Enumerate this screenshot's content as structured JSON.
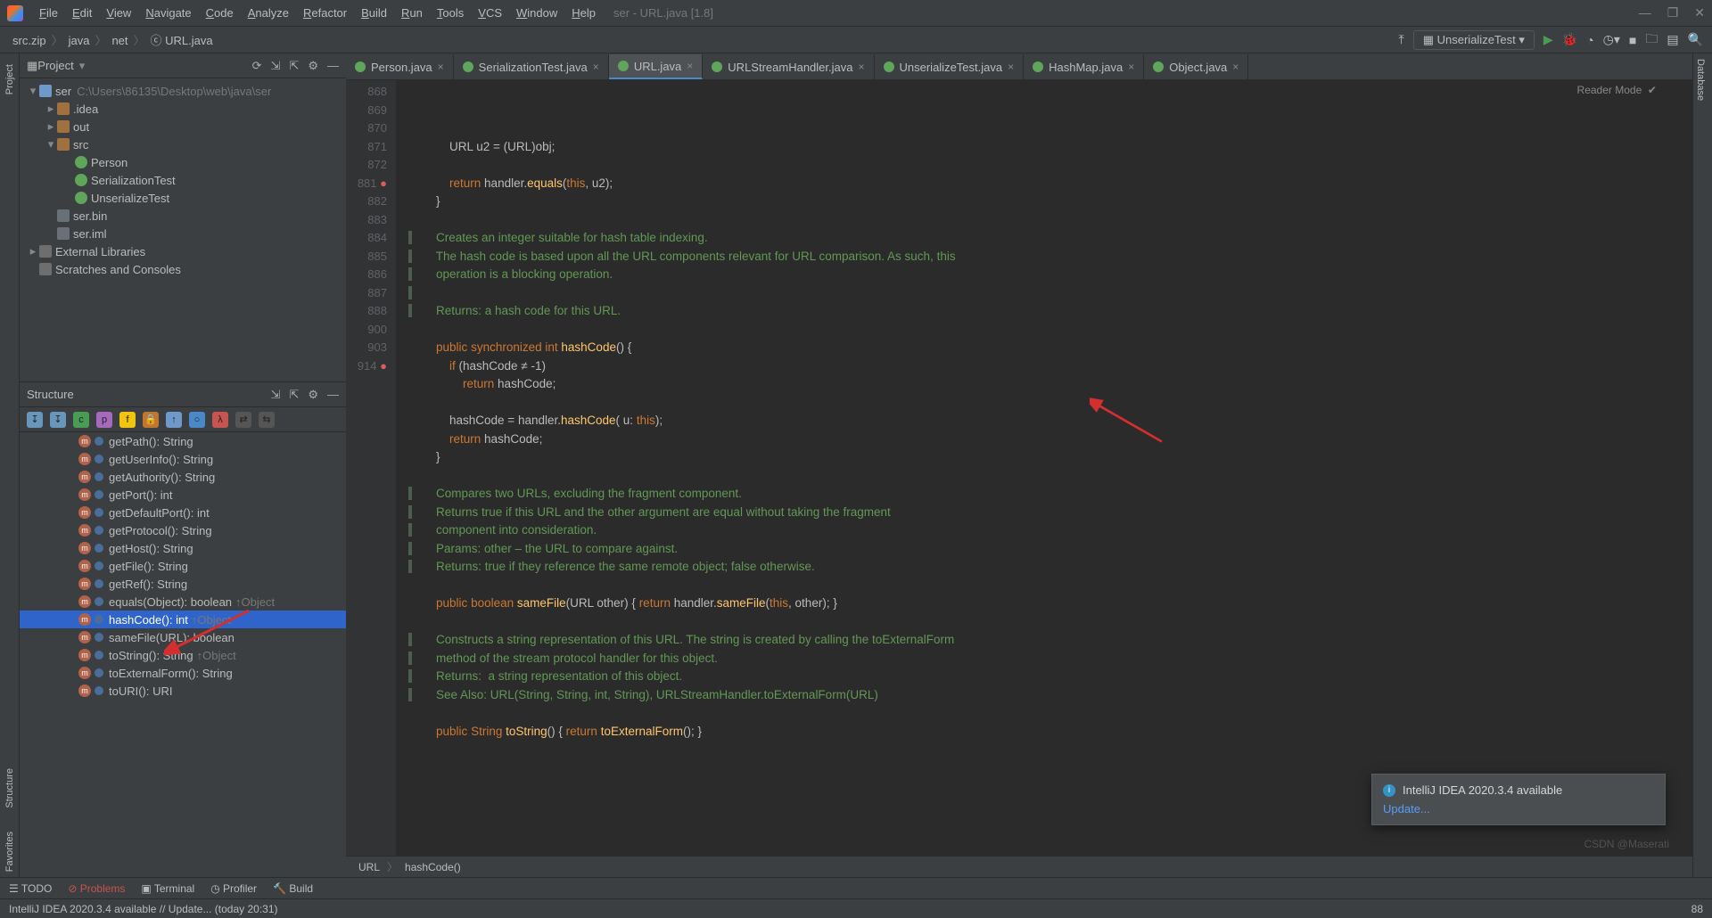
{
  "menubar": {
    "items": [
      "File",
      "Edit",
      "View",
      "Navigate",
      "Code",
      "Analyze",
      "Refactor",
      "Build",
      "Run",
      "Tools",
      "VCS",
      "Window",
      "Help"
    ],
    "title_hint": "ser - URL.java [1.8]"
  },
  "breadcrumb": {
    "parts": [
      "src.zip",
      "java",
      "net",
      "URL.java"
    ]
  },
  "toolbar": {
    "run_config_label": "UnserializeTest"
  },
  "project": {
    "title": "Project",
    "tree": [
      {
        "depth": 0,
        "exp": "▾",
        "icon": "module",
        "label": "ser",
        "muted": "C:\\Users\\86135\\Desktop\\web\\java\\ser"
      },
      {
        "depth": 1,
        "exp": "▸",
        "icon": "folder",
        "label": ".idea"
      },
      {
        "depth": 1,
        "exp": "▸",
        "icon": "folder",
        "label": "out"
      },
      {
        "depth": 1,
        "exp": "▾",
        "icon": "folder",
        "label": "src"
      },
      {
        "depth": 2,
        "exp": "",
        "icon": "class",
        "label": "Person"
      },
      {
        "depth": 2,
        "exp": "",
        "icon": "class",
        "label": "SerializationTest"
      },
      {
        "depth": 2,
        "exp": "",
        "icon": "class",
        "label": "UnserializeTest"
      },
      {
        "depth": 1,
        "exp": "",
        "icon": "file",
        "label": "ser.bin"
      },
      {
        "depth": 1,
        "exp": "",
        "icon": "file",
        "label": "ser.iml"
      },
      {
        "depth": 0,
        "exp": "▸",
        "icon": "lib",
        "label": "External Libraries"
      },
      {
        "depth": 0,
        "exp": "",
        "icon": "lib",
        "label": "Scratches and Consoles"
      }
    ]
  },
  "structure": {
    "title": "Structure",
    "items": [
      {
        "label": "getPath(): String"
      },
      {
        "label": "getUserInfo(): String"
      },
      {
        "label": "getAuthority(): String"
      },
      {
        "label": "getPort(): int"
      },
      {
        "label": "getDefaultPort(): int"
      },
      {
        "label": "getProtocol(): String"
      },
      {
        "label": "getHost(): String"
      },
      {
        "label": "getFile(): String"
      },
      {
        "label": "getRef(): String"
      },
      {
        "label": "equals(Object): boolean",
        "inherit": "↑Object"
      },
      {
        "label": "hashCode(): int",
        "inherit": "↑Object",
        "selected": true
      },
      {
        "label": "sameFile(URL): boolean"
      },
      {
        "label": "toString(): String",
        "inherit": "↑Object"
      },
      {
        "label": "toExternalForm(): String"
      },
      {
        "label": "toURI(): URI"
      }
    ]
  },
  "tabs": [
    {
      "label": "Person.java"
    },
    {
      "label": "SerializationTest.java"
    },
    {
      "label": "URL.java",
      "active": true
    },
    {
      "label": "URLStreamHandler.java"
    },
    {
      "label": "UnserializeTest.java"
    },
    {
      "label": "HashMap.java"
    },
    {
      "label": "Object.java"
    }
  ],
  "editor": {
    "reader_mode": "Reader Mode",
    "gutter_lines": [
      "868",
      "869",
      "870",
      "871",
      "872",
      "",
      "",
      "",
      "",
      "",
      "",
      "881",
      "882",
      "883",
      "884",
      "885",
      "886",
      "887",
      "888",
      "",
      "",
      "",
      "",
      "",
      "",
      "900",
      "903",
      "",
      "",
      "",
      "",
      "",
      "914"
    ],
    "breakpoint_lines": [
      "881",
      "914"
    ],
    "code_lines": [
      "        URL u2 = (URL)obj;",
      "",
      "        return handler.equals(this, u2);",
      "    }",
      "",
      "    Creates an integer suitable for hash table indexing.",
      "    The hash code is based upon all the URL components relevant for URL comparison. As such, this",
      "    operation is a blocking operation.",
      "",
      "    Returns: a hash code for this URL.",
      "",
      "    public synchronized int hashCode() {",
      "        if (hashCode ≠ -1)",
      "            return hashCode;",
      "",
      "        hashCode = handler.hashCode( u: this);",
      "        return hashCode;",
      "    }",
      "",
      "    Compares two URLs, excluding the fragment component.",
      "    Returns true if this URL and the other argument are equal without taking the fragment",
      "    component into consideration.",
      "    Params: other – the URL to compare against.",
      "    Returns: true if they reference the same remote object; false otherwise.",
      "",
      "    public boolean sameFile(URL other) { return handler.sameFile(this, other); }",
      "",
      "    Constructs a string representation of this URL. The string is created by calling the toExternalForm",
      "    method of the stream protocol handler for this object.",
      "    Returns:  a string representation of this object.",
      "    See Also: URL(String, String, int, String), URLStreamHandler.toExternalForm(URL)",
      "",
      "    public String toString() { return toExternalForm(); }"
    ]
  },
  "editor_breadcrumb": {
    "parts": [
      "URL",
      "hashCode()"
    ]
  },
  "bottom_tools": {
    "items": [
      "TODO",
      "Problems",
      "Terminal",
      "Profiler",
      "Build"
    ]
  },
  "statusbar": {
    "left": "IntelliJ IDEA 2020.3.4 available // Update... (today 20:31)",
    "right_items": [
      "88"
    ]
  },
  "notification": {
    "title": "IntelliJ IDEA 2020.3.4 available",
    "link": "Update..."
  },
  "watermark": "CSDN @Maserati",
  "rightrail": "Database",
  "leftrail_tabs": [
    "Project",
    "Structure",
    "Favorites"
  ]
}
